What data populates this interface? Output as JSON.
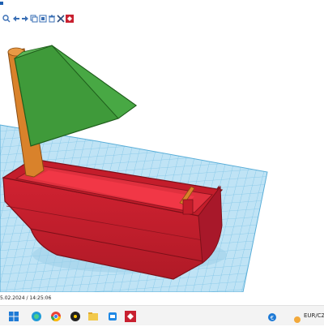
{
  "status": {
    "timestamp": "5.02.2024 / 14:25:06"
  },
  "toolbar": {
    "icons": [
      "zoom-icon",
      "undo-icon",
      "redo-icon",
      "copy-icon",
      "duplicate-icon",
      "delete-icon",
      "tools-icon",
      "tinkercad-logo-icon"
    ]
  },
  "taskbar": {
    "apps": [
      "windows-start",
      "chrome-app",
      "media-app",
      "file-explorer-app",
      "tinkercad-app"
    ],
    "tray_label": "EUR/CZ"
  },
  "colors": {
    "grid": "#cfe8f5",
    "grid_line": "#7cc3e6",
    "hull": "#c8202f",
    "hull_dark": "#9c1522",
    "sail": "#3f9a3a",
    "sail_dark": "#2d7a2a",
    "mast": "#d9822b"
  }
}
